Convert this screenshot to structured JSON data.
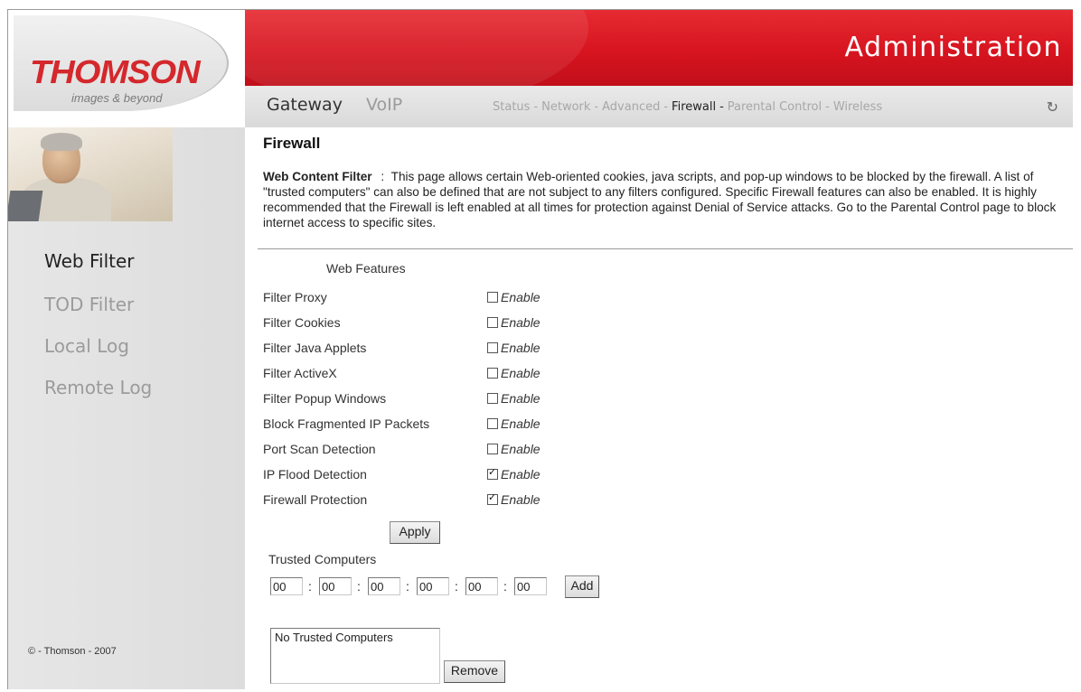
{
  "header": {
    "logo_text": "THOMSON",
    "logo_tagline": "images & beyond",
    "admin_title": "Administration",
    "brand_color": "#d7141f"
  },
  "nav": {
    "main": [
      "Gateway",
      "VoIP"
    ],
    "sub": [
      "Status",
      "Network",
      "Advanced",
      "Firewall",
      "Parental Control",
      "Wireless"
    ],
    "sub_separator": "-",
    "active_sub": "Firewall",
    "spinner_icon": "refresh-icon"
  },
  "sidebar": {
    "items": [
      "Web Filter",
      "TOD Filter",
      "Local Log",
      "Remote Log"
    ],
    "active": "Web Filter",
    "copyright": "© - Thomson - 2007"
  },
  "content": {
    "title": "Firewall",
    "desc_lead": "Web Content Filter",
    "desc_sep": ":",
    "desc_text": "This page allows certain Web-oriented cookies, java scripts, and pop-up windows to be blocked by the firewall. A list of \"trusted computers\" can also be defined that are not subject to any filters configured. Specific Firewall features can also be enabled. It is highly recommended that the Firewall is left enabled at all times for protection against Denial of Service attacks. Go to the Parental Control page to block internet access to specific sites.",
    "features_header": "Web Features",
    "option_label": "Enable",
    "features": [
      {
        "label": "Filter Proxy",
        "enabled": false
      },
      {
        "label": "Filter Cookies",
        "enabled": false
      },
      {
        "label": "Filter Java Applets",
        "enabled": false
      },
      {
        "label": "Filter ActiveX",
        "enabled": false
      },
      {
        "label": "Filter Popup Windows",
        "enabled": false
      },
      {
        "label": "Block Fragmented IP Packets",
        "enabled": false
      },
      {
        "label": "Port Scan Detection",
        "enabled": false
      },
      {
        "label": "IP Flood Detection",
        "enabled": true
      },
      {
        "label": "Firewall Protection",
        "enabled": true
      }
    ],
    "apply_label": "Apply",
    "trusted_label": "Trusted Computers",
    "mac_values": [
      "00",
      "00",
      "00",
      "00",
      "00",
      "00"
    ],
    "mac_separator": ":",
    "add_label": "Add",
    "trusted_list": [
      "No Trusted Computers"
    ],
    "remove_label": "Remove"
  }
}
